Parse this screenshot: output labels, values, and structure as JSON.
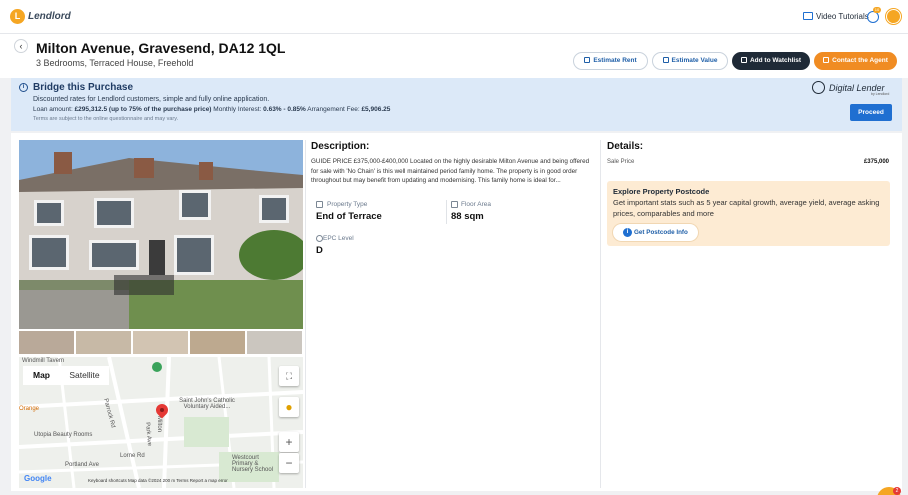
{
  "brand": {
    "logo_letter": "L",
    "name": "Lendlord"
  },
  "topbar": {
    "video_tutorials": "Video Tutorials",
    "notifications_count": "10"
  },
  "property": {
    "title": "Milton Avenue, Gravesend, DA12 1QL",
    "subtitle": "3 Bedrooms, Terraced House, Freehold"
  },
  "actions": {
    "estimate_rent": "Estimate Rent",
    "estimate_value": "Estimate Value",
    "add_to_watchlist": "Add to Watchlist",
    "contact_agent": "Contact the Agent"
  },
  "bridge": {
    "title": "Bridge this Purchase",
    "line1": "Discounted rates for Lendlord customers, simple and fully online application.",
    "loan_label": "Loan amount: ",
    "loan_value": "£295,312.5 (up to 75% of the purchase price)",
    "interest_label": " Monthly Interest: ",
    "interest_value": "0.63% - 0.85%",
    "fee_label": " Arrangement Fee: ",
    "fee_value": "£5,906.25",
    "terms": "Terms are subject to the online questionnaire and may vary.",
    "partner_name": "Digital Lender",
    "partner_sub": "by Lendlord",
    "proceed": "Proceed"
  },
  "map": {
    "tab_map": "Map",
    "tab_satellite": "Satellite",
    "labels": {
      "windmill": "Windmill Tavern",
      "orange": "Orange",
      "utopia": "Utopia Beauty Rooms",
      "school": "Saint John's Catholic Voluntary Aided...",
      "westcourt": "Westcourt Primary & Nursery School",
      "parrock_rd": "Parrock Rd",
      "park_ave": "Park Ave",
      "portland_ave": "Portland Ave",
      "milton": "Milton",
      "lorne_rd": "Lorne Rd"
    },
    "google": "Google",
    "footer": "Keyboard shortcuts    Map data ©2024    200 m          Terms    Report a map error"
  },
  "description": {
    "heading": "Description:",
    "body": "GUIDE PRICE £375,000-£400,000 Located on the highly desirable Milton Avenue and being offered for sale with 'No Chain' is this well maintained period family home. The property is in good order throughout but may benefit from updating and modernising. This family home is ideal for..."
  },
  "features": {
    "type_label": "Property Type",
    "type_value": "End of Terrace",
    "area_label": "Floor Area",
    "area_value": "88 sqm",
    "epc_label": "EPC Level",
    "epc_value": "D"
  },
  "details": {
    "heading": "Details:",
    "sale_price_label": "Sale Price",
    "sale_price_value": "£375,000"
  },
  "postcode": {
    "title": "Explore Property Postcode",
    "body": "Get important stats such as 5 year capital growth, average yield, average asking prices, comparables and more",
    "button": "Get Postcode Info"
  },
  "colors": {
    "accent_blue": "#1f6fd1",
    "brand_orange": "#f08c23",
    "banner_bg": "#dce9f8",
    "postcode_bg": "#fdebd3"
  }
}
